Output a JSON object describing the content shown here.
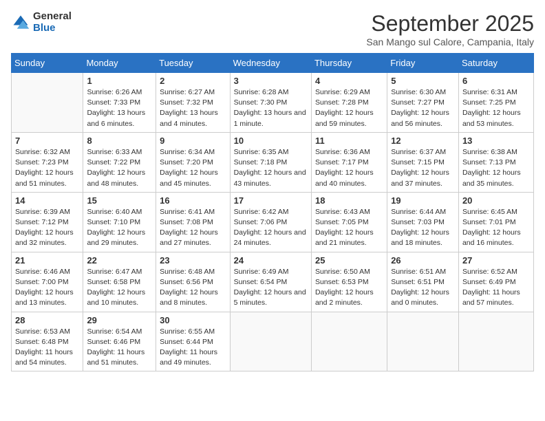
{
  "logo": {
    "general": "General",
    "blue": "Blue"
  },
  "title": "September 2025",
  "location": "San Mango sul Calore, Campania, Italy",
  "weekdays": [
    "Sunday",
    "Monday",
    "Tuesday",
    "Wednesday",
    "Thursday",
    "Friday",
    "Saturday"
  ],
  "weeks": [
    [
      {
        "day": "",
        "sunrise": "",
        "sunset": "",
        "daylight": ""
      },
      {
        "day": "1",
        "sunrise": "Sunrise: 6:26 AM",
        "sunset": "Sunset: 7:33 PM",
        "daylight": "Daylight: 13 hours and 6 minutes."
      },
      {
        "day": "2",
        "sunrise": "Sunrise: 6:27 AM",
        "sunset": "Sunset: 7:32 PM",
        "daylight": "Daylight: 13 hours and 4 minutes."
      },
      {
        "day": "3",
        "sunrise": "Sunrise: 6:28 AM",
        "sunset": "Sunset: 7:30 PM",
        "daylight": "Daylight: 13 hours and 1 minute."
      },
      {
        "day": "4",
        "sunrise": "Sunrise: 6:29 AM",
        "sunset": "Sunset: 7:28 PM",
        "daylight": "Daylight: 12 hours and 59 minutes."
      },
      {
        "day": "5",
        "sunrise": "Sunrise: 6:30 AM",
        "sunset": "Sunset: 7:27 PM",
        "daylight": "Daylight: 12 hours and 56 minutes."
      },
      {
        "day": "6",
        "sunrise": "Sunrise: 6:31 AM",
        "sunset": "Sunset: 7:25 PM",
        "daylight": "Daylight: 12 hours and 53 minutes."
      }
    ],
    [
      {
        "day": "7",
        "sunrise": "Sunrise: 6:32 AM",
        "sunset": "Sunset: 7:23 PM",
        "daylight": "Daylight: 12 hours and 51 minutes."
      },
      {
        "day": "8",
        "sunrise": "Sunrise: 6:33 AM",
        "sunset": "Sunset: 7:22 PM",
        "daylight": "Daylight: 12 hours and 48 minutes."
      },
      {
        "day": "9",
        "sunrise": "Sunrise: 6:34 AM",
        "sunset": "Sunset: 7:20 PM",
        "daylight": "Daylight: 12 hours and 45 minutes."
      },
      {
        "day": "10",
        "sunrise": "Sunrise: 6:35 AM",
        "sunset": "Sunset: 7:18 PM",
        "daylight": "Daylight: 12 hours and 43 minutes."
      },
      {
        "day": "11",
        "sunrise": "Sunrise: 6:36 AM",
        "sunset": "Sunset: 7:17 PM",
        "daylight": "Daylight: 12 hours and 40 minutes."
      },
      {
        "day": "12",
        "sunrise": "Sunrise: 6:37 AM",
        "sunset": "Sunset: 7:15 PM",
        "daylight": "Daylight: 12 hours and 37 minutes."
      },
      {
        "day": "13",
        "sunrise": "Sunrise: 6:38 AM",
        "sunset": "Sunset: 7:13 PM",
        "daylight": "Daylight: 12 hours and 35 minutes."
      }
    ],
    [
      {
        "day": "14",
        "sunrise": "Sunrise: 6:39 AM",
        "sunset": "Sunset: 7:12 PM",
        "daylight": "Daylight: 12 hours and 32 minutes."
      },
      {
        "day": "15",
        "sunrise": "Sunrise: 6:40 AM",
        "sunset": "Sunset: 7:10 PM",
        "daylight": "Daylight: 12 hours and 29 minutes."
      },
      {
        "day": "16",
        "sunrise": "Sunrise: 6:41 AM",
        "sunset": "Sunset: 7:08 PM",
        "daylight": "Daylight: 12 hours and 27 minutes."
      },
      {
        "day": "17",
        "sunrise": "Sunrise: 6:42 AM",
        "sunset": "Sunset: 7:06 PM",
        "daylight": "Daylight: 12 hours and 24 minutes."
      },
      {
        "day": "18",
        "sunrise": "Sunrise: 6:43 AM",
        "sunset": "Sunset: 7:05 PM",
        "daylight": "Daylight: 12 hours and 21 minutes."
      },
      {
        "day": "19",
        "sunrise": "Sunrise: 6:44 AM",
        "sunset": "Sunset: 7:03 PM",
        "daylight": "Daylight: 12 hours and 18 minutes."
      },
      {
        "day": "20",
        "sunrise": "Sunrise: 6:45 AM",
        "sunset": "Sunset: 7:01 PM",
        "daylight": "Daylight: 12 hours and 16 minutes."
      }
    ],
    [
      {
        "day": "21",
        "sunrise": "Sunrise: 6:46 AM",
        "sunset": "Sunset: 7:00 PM",
        "daylight": "Daylight: 12 hours and 13 minutes."
      },
      {
        "day": "22",
        "sunrise": "Sunrise: 6:47 AM",
        "sunset": "Sunset: 6:58 PM",
        "daylight": "Daylight: 12 hours and 10 minutes."
      },
      {
        "day": "23",
        "sunrise": "Sunrise: 6:48 AM",
        "sunset": "Sunset: 6:56 PM",
        "daylight": "Daylight: 12 hours and 8 minutes."
      },
      {
        "day": "24",
        "sunrise": "Sunrise: 6:49 AM",
        "sunset": "Sunset: 6:54 PM",
        "daylight": "Daylight: 12 hours and 5 minutes."
      },
      {
        "day": "25",
        "sunrise": "Sunrise: 6:50 AM",
        "sunset": "Sunset: 6:53 PM",
        "daylight": "Daylight: 12 hours and 2 minutes."
      },
      {
        "day": "26",
        "sunrise": "Sunrise: 6:51 AM",
        "sunset": "Sunset: 6:51 PM",
        "daylight": "Daylight: 12 hours and 0 minutes."
      },
      {
        "day": "27",
        "sunrise": "Sunrise: 6:52 AM",
        "sunset": "Sunset: 6:49 PM",
        "daylight": "Daylight: 11 hours and 57 minutes."
      }
    ],
    [
      {
        "day": "28",
        "sunrise": "Sunrise: 6:53 AM",
        "sunset": "Sunset: 6:48 PM",
        "daylight": "Daylight: 11 hours and 54 minutes."
      },
      {
        "day": "29",
        "sunrise": "Sunrise: 6:54 AM",
        "sunset": "Sunset: 6:46 PM",
        "daylight": "Daylight: 11 hours and 51 minutes."
      },
      {
        "day": "30",
        "sunrise": "Sunrise: 6:55 AM",
        "sunset": "Sunset: 6:44 PM",
        "daylight": "Daylight: 11 hours and 49 minutes."
      },
      {
        "day": "",
        "sunrise": "",
        "sunset": "",
        "daylight": ""
      },
      {
        "day": "",
        "sunrise": "",
        "sunset": "",
        "daylight": ""
      },
      {
        "day": "",
        "sunrise": "",
        "sunset": "",
        "daylight": ""
      },
      {
        "day": "",
        "sunrise": "",
        "sunset": "",
        "daylight": ""
      }
    ]
  ]
}
